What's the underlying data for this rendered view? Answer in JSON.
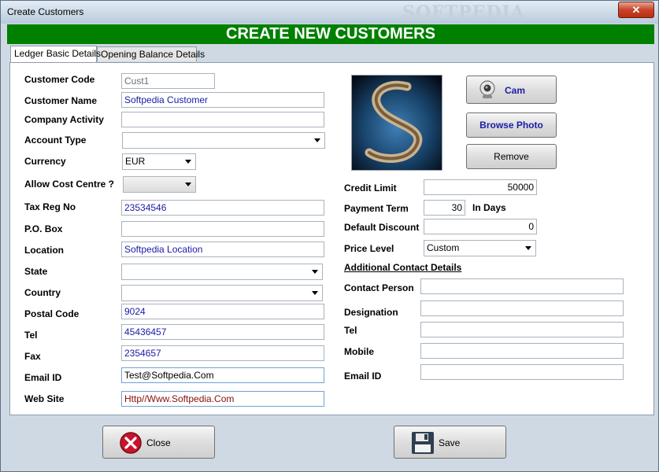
{
  "window": {
    "title": "Create Customers",
    "close_glyph": "✕",
    "watermark": "SOFTPEDIA"
  },
  "header": {
    "title": "CREATE NEW CUSTOMERS"
  },
  "tabs": [
    {
      "label": "Ledger Basic Details"
    },
    {
      "label": "Opening Balance Details"
    }
  ],
  "form": {
    "customer_code": {
      "label": "Customer Code",
      "value": "Cust1"
    },
    "customer_name": {
      "label": "Customer Name",
      "value": "Softpedia Customer"
    },
    "company_activity": {
      "label": "Company Activity",
      "value": ""
    },
    "account_type": {
      "label": "Account Type",
      "value": ""
    },
    "currency": {
      "label": "Currency",
      "value": "EUR"
    },
    "allow_cost_centre": {
      "label": "Allow Cost Centre ?",
      "value": ""
    },
    "tax_reg_no": {
      "label": "Tax Reg No",
      "value": "23534546"
    },
    "po_box": {
      "label": "P.O. Box",
      "value": ""
    },
    "location": {
      "label": "Location",
      "value": "Softpedia Location"
    },
    "state": {
      "label": "State",
      "value": ""
    },
    "country": {
      "label": "Country",
      "value": ""
    },
    "postal_code": {
      "label": "Postal Code",
      "value": "9024"
    },
    "tel": {
      "label": "Tel",
      "value": "45436457"
    },
    "fax": {
      "label": "Fax",
      "value": "2354657"
    },
    "email": {
      "label": "Email ID",
      "value": "Test@Softpedia.Com"
    },
    "website": {
      "label": "Web Site",
      "value": "Http//Www.Softpedia.Com"
    }
  },
  "photo_buttons": {
    "cam": "Cam",
    "browse": "Browse Photo",
    "remove": "Remove"
  },
  "right_form": {
    "credit_limit": {
      "label": "Credit Limit",
      "value": "50000"
    },
    "payment_term": {
      "label": "Payment Term",
      "value": "30",
      "suffix": "In Days"
    },
    "default_discount": {
      "label": "Default Discount",
      "value": "0"
    },
    "price_level": {
      "label": "Price Level",
      "value": "Custom"
    }
  },
  "additional": {
    "heading": "Additional Contact Details",
    "contact_person": {
      "label": "Contact Person",
      "value": ""
    },
    "designation": {
      "label": "Designation",
      "value": ""
    },
    "tel": {
      "label": "Tel",
      "value": ""
    },
    "mobile": {
      "label": "Mobile",
      "value": ""
    },
    "email": {
      "label": "Email ID",
      "value": ""
    }
  },
  "footer": {
    "close_label": "Close",
    "save_label": "Save"
  },
  "colors": {
    "header_green": "#008000",
    "link_blue": "#1c1ca8",
    "close_red": "#c8142a"
  }
}
